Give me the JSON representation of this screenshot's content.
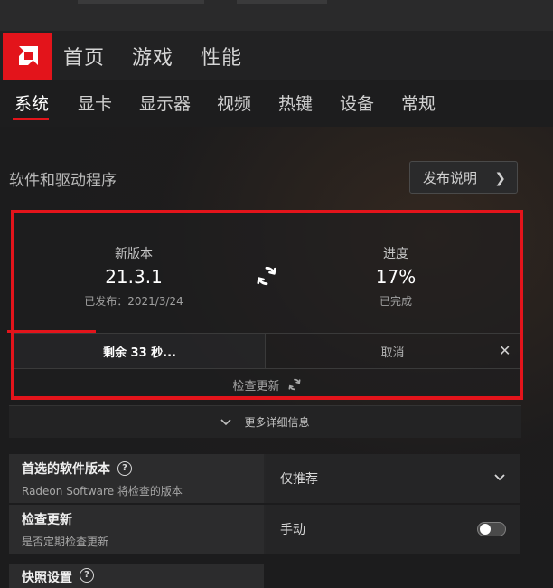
{
  "top_nav": {
    "items": [
      "首页",
      "游戏",
      "性能"
    ]
  },
  "sub_nav": {
    "items": [
      "系统",
      "显卡",
      "显示器",
      "视频",
      "热键",
      "设备",
      "常规"
    ],
    "active_index": 0
  },
  "section": {
    "title": "软件和驱动程序",
    "release_notes_button": "发布说明"
  },
  "update_panel": {
    "new_version_label": "新版本",
    "new_version_value": "21.3.1",
    "released_text": "已发布：2021/3/24",
    "progress_label": "进度",
    "progress_value": "17%",
    "progress_fraction": 0.17,
    "progress_status": "已完成",
    "remaining_text": "剩余 33 秒...",
    "cancel_label": "取消",
    "check_update_label": "检查更新"
  },
  "more_details_label": "更多详细信息",
  "settings": [
    {
      "title": "首选的软件版本",
      "desc": "Radeon Software 将检查的版本",
      "value": "仅推荐",
      "has_help": true,
      "control": "dropdown"
    },
    {
      "title": "检查更新",
      "desc": "是否定期检查更新",
      "value": "手动",
      "has_help": false,
      "control": "toggle",
      "toggle_on": false
    }
  ],
  "partial_row_title": "快照设置",
  "colors": {
    "accent": "#e3141b",
    "background": "#1c1c1d"
  }
}
